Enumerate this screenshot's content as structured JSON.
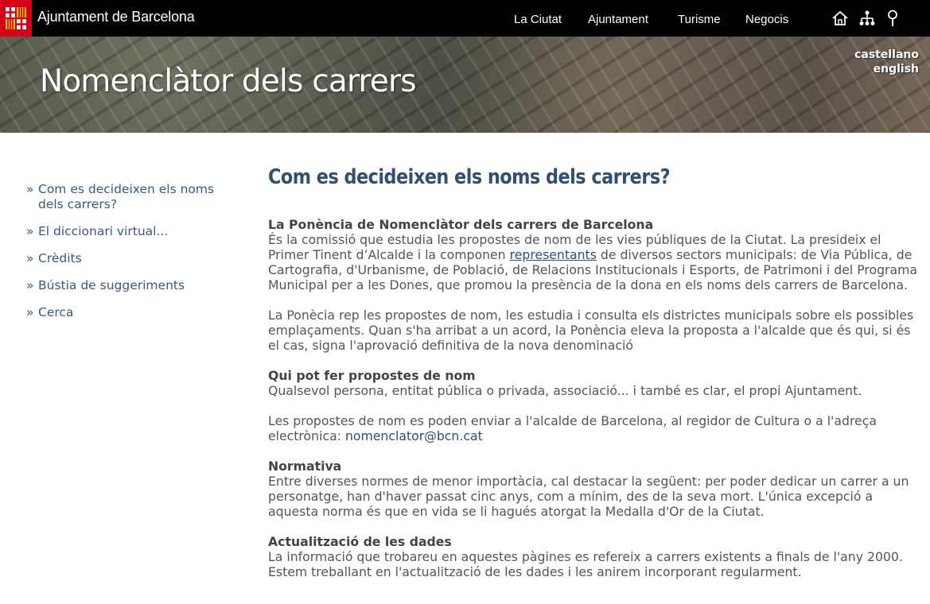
{
  "header": {
    "site_name": "Ajuntament de Barcelona",
    "nav": [
      "La Ciutat",
      "Ajuntament",
      "Turisme",
      "Negocis"
    ],
    "icons": [
      "home-icon",
      "sitemap-icon",
      "search-icon"
    ]
  },
  "banner": {
    "title": "Nomenclàtor dels carrers",
    "languages": [
      "castellano",
      "english"
    ]
  },
  "sidebar": {
    "items": [
      {
        "label": "Com es decideixen els noms dels carrers?"
      },
      {
        "label": "El diccionari virtual..."
      },
      {
        "label": "Crèdits"
      },
      {
        "label": "Bústia de suggeriments"
      },
      {
        "label": "Cerca"
      }
    ]
  },
  "main": {
    "title": "Com es decideixen els noms dels carrers?",
    "s1": {
      "heading": "La Ponència de Nomenclàtor dels carrers de Barcelona",
      "p1_before": "És la comissió que estudia les propostes de nom de les vies públiques de la Ciutat. La presideix el Primer Tinent d’Alcalde i la componen ",
      "p1_link": "representants",
      "p1_after": " de diversos sectors municipals: de Via Pública, de Cartografia, d'Urbanisme, de Població, de Relacions Institucionals i Esports, de Patrimoni i del Programa Municipal per a les Dones, que promou la presència de la dona en els noms dels carrers de Barcelona.",
      "p2": "La Ponècia rep les propostes de nom, les estudia i consulta els districtes municipals sobre els possibles emplaçaments. Quan s'ha arribat a un acord, la Ponència eleva la proposta a l'alcalde que és qui, si és el cas, signa l'aprovació definitiva de la nova denominació"
    },
    "s2": {
      "heading": "Qui pot fer propostes de nom",
      "p1": "Qualsevol persona, entitat pública o privada, associació... i també es clar, el propi Ajuntament.",
      "p2_before": "Les propostes de nom es poden enviar a l'alcalde de Barcelona, al regidor de Cultura o a l'adreça electrònica: ",
      "email": "nomenclator@bcn.cat"
    },
    "s3": {
      "heading": "Normativa",
      "p1": "Entre diverses normes de menor importàcia, cal destacar la següent: per poder dedicar un carrer a un personatge, han d'haver passat cinc anys, com a mínim, des de la seva mort. L'única excepció a aquesta norma és que en vida se li hagués atorgat la Medalla d'Or de la Ciutat."
    },
    "s4": {
      "heading": "Actualització de les dades",
      "p1": "La informació que trobareu en aquestes pàgines es refereix a carrers existents a finals de l'any 2000. Estem treballant en l'actualització de les dades i les anirem incorporant regularment."
    }
  },
  "colors": {
    "logo_red": "#d4001a",
    "title_blue": "#2f4f75",
    "link_blue": "#3a5a78",
    "body_text": "#555555"
  }
}
